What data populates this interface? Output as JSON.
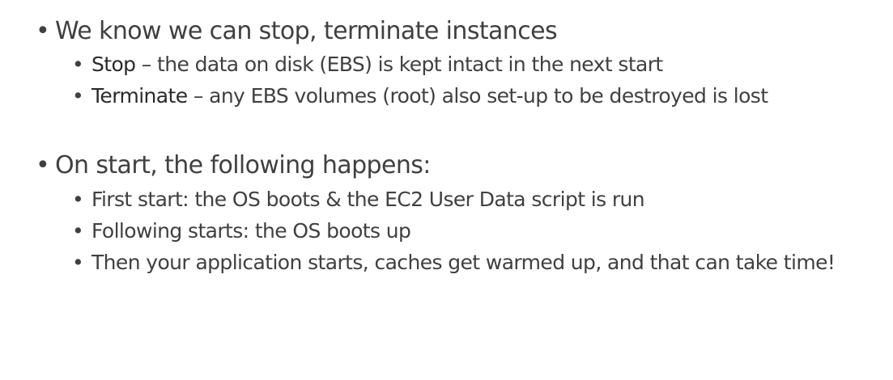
{
  "sections": [
    {
      "heading": "We know we can stop, terminate instances",
      "items": [
        {
          "term": "Stop",
          "text": " – the data on disk (EBS) is kept intact in the next start"
        },
        {
          "term": "Terminate",
          "text": " – any EBS volumes (root) also set-up to be destroyed is lost"
        }
      ]
    },
    {
      "heading": "On start, the following happens:",
      "items": [
        {
          "text": "First start: the OS boots & the EC2 User Data script is run"
        },
        {
          "text": "Following starts: the OS boots up"
        },
        {
          "text": "Then your application starts, caches get warmed up, and that can take time!"
        }
      ]
    }
  ],
  "bullet_char": "•"
}
